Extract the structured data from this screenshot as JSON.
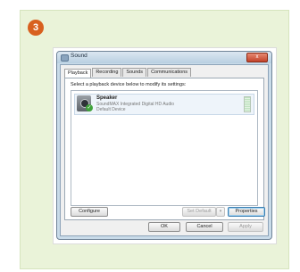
{
  "step": {
    "number": "3"
  },
  "colors": {
    "card_bg": "#eaf3d9",
    "badge": "#d8601f",
    "close_button": "#c2422a"
  },
  "window": {
    "title": "Sound",
    "close_label": "x",
    "tabs": [
      {
        "label": "Playback",
        "active": true
      },
      {
        "label": "Recording"
      },
      {
        "label": "Sounds"
      },
      {
        "label": "Communications"
      }
    ],
    "instruction": "Select a playback device below to modify its settings:",
    "devices": [
      {
        "name": "Speaker",
        "description": "SoundMAX Integrated Digital HD Audio",
        "status": "Default Device",
        "icon": "speaker-icon",
        "default_icon": "check-icon"
      }
    ],
    "buttons": {
      "configure": "Configure",
      "set_default": "Set Default",
      "set_default_dropdown": "▾",
      "properties": "Properties",
      "ok": "OK",
      "cancel": "Cancel",
      "apply": "Apply"
    }
  }
}
